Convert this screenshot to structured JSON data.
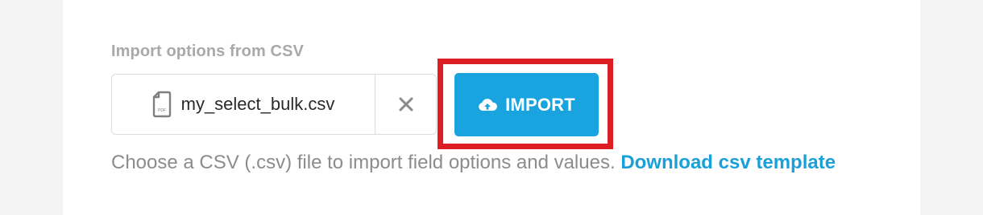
{
  "import": {
    "section_label": "Import options from CSV",
    "file_name": "my_select_bulk.csv",
    "file_icon_caption": "PDF",
    "remove_symbol": "✕",
    "button_label": "IMPORT",
    "help_text": "Choose a CSV (.csv) file to import field options and values.",
    "link_label": "Download csv template"
  },
  "icons": {
    "file": "file-icon",
    "remove": "close-icon",
    "upload": "cloud-upload-icon"
  },
  "colors": {
    "accent": "#19a4e0",
    "link": "#1a9fd9",
    "highlight": "#dd1f24",
    "label": "#a9a9a9",
    "help_text": "#8c8c8c"
  }
}
